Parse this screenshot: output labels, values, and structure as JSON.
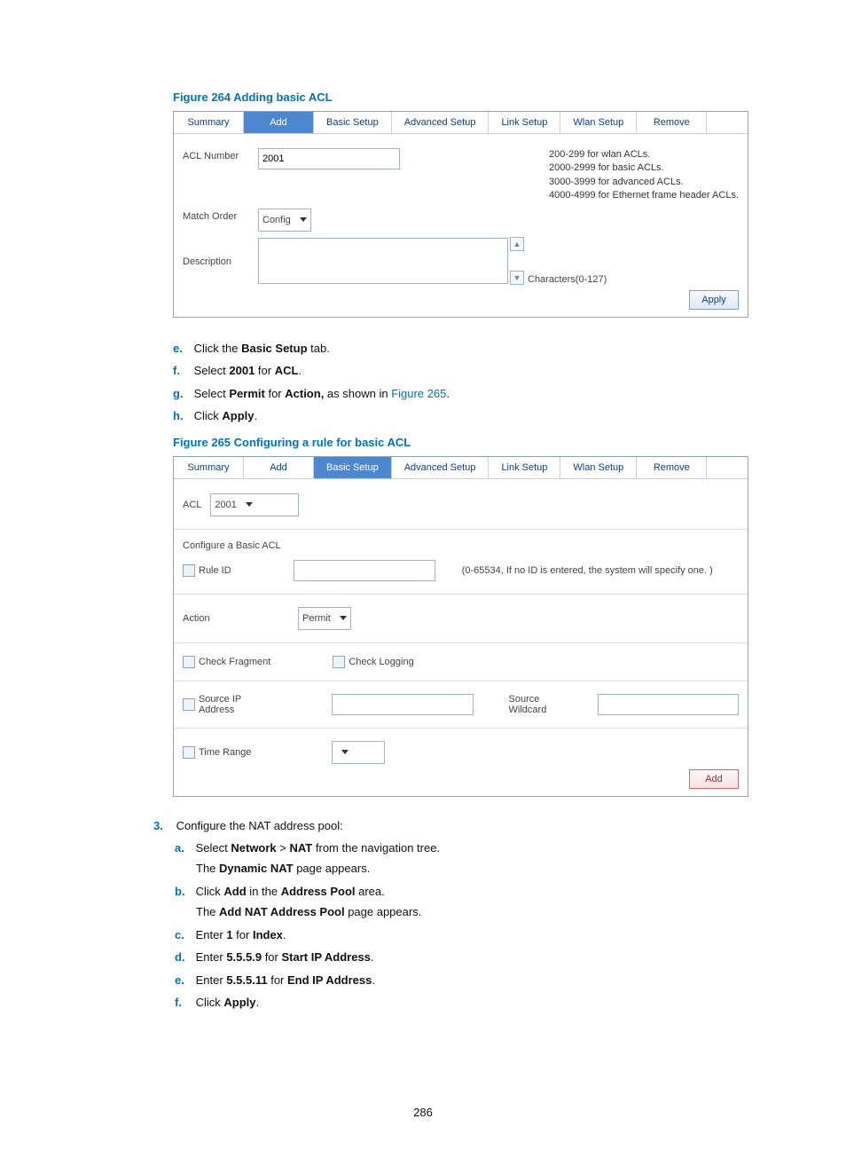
{
  "fig264": {
    "caption": "Figure 264 Adding basic ACL",
    "tabs": [
      "Summary",
      "Add",
      "Basic Setup",
      "Advanced Setup",
      "Link Setup",
      "Wlan Setup",
      "Remove"
    ],
    "acl_number_label": "ACL Number",
    "acl_number_value": "2001",
    "hints": [
      "200-299 for wlan ACLs.",
      "2000-2999 for basic ACLs.",
      "3000-3999 for advanced ACLs.",
      "4000-4999 for Ethernet frame header ACLs."
    ],
    "match_order_label": "Match Order",
    "match_order_value": "Config",
    "description_label": "Description",
    "chars_hint": "Characters(0-127)",
    "apply": "Apply"
  },
  "steps1": {
    "e": [
      "Click the ",
      "Basic Setup",
      " tab."
    ],
    "f": [
      "Select ",
      "2001",
      " for ",
      "ACL",
      "."
    ],
    "g_pre": "Select ",
    "g_strong1": "Permit",
    "g_mid": " for ",
    "g_strong2": "Action,",
    "g_post": " as shown in ",
    "g_link": "Figure 265",
    "g_end": ".",
    "h": [
      "Click ",
      "Apply",
      "."
    ]
  },
  "fig265": {
    "caption": "Figure 265 Configuring a rule for basic ACL",
    "tabs": [
      "Summary",
      "Add",
      "Basic Setup",
      "Advanced Setup",
      "Link Setup",
      "Wlan Setup",
      "Remove"
    ],
    "acl_label": "ACL",
    "acl_value": "2001",
    "config_heading": "Configure a Basic ACL",
    "rule_id": "Rule ID",
    "rule_hint": "(0-65534, If no ID is entered, the system will specify one. )",
    "action_label": "Action",
    "action_value": "Permit",
    "check_fragment": "Check Fragment",
    "check_logging": "Check Logging",
    "source_ip": "Source IP Address",
    "source_wildcard": "Source Wildcard",
    "time_range": "Time Range",
    "add": "Add"
  },
  "step3_intro": "Configure the NAT address pool:",
  "steps3": {
    "a1": "Select ",
    "a_strong1": "Network",
    "a_gt": " > ",
    "a_strong2": "NAT",
    "a2": " from the navigation tree.",
    "a_line2_pre": "The ",
    "a_line2_strong": "Dynamic NAT",
    "a_line2_post": " page appears.",
    "b1": "Click ",
    "b_strong1": "Add",
    "b2": " in the ",
    "b_strong2": "Address Pool",
    "b3": " area.",
    "b_line2_pre": "The ",
    "b_line2_strong": "Add NAT Address Pool",
    "b_line2_post": " page appears.",
    "c1": "Enter ",
    "c_strong1": "1",
    "c2": " for ",
    "c_strong2": "Index",
    "c3": ".",
    "d1": "Enter ",
    "d_strong1": "5.5.5.9",
    "d2": " for ",
    "d_strong2": "Start IP Address",
    "d3": ".",
    "e1": "Enter ",
    "e_strong1": "5.5.5.11",
    "e2": " for ",
    "e_strong2": "End IP Address",
    "e3": ".",
    "f1": "Click ",
    "f_strong": "Apply",
    "f2": "."
  },
  "page_number": "286",
  "markers": {
    "e": "e.",
    "f": "f.",
    "g": "g.",
    "h": "h.",
    "a": "a.",
    "b": "b.",
    "c": "c.",
    "d": "d.",
    "n3": "3."
  }
}
